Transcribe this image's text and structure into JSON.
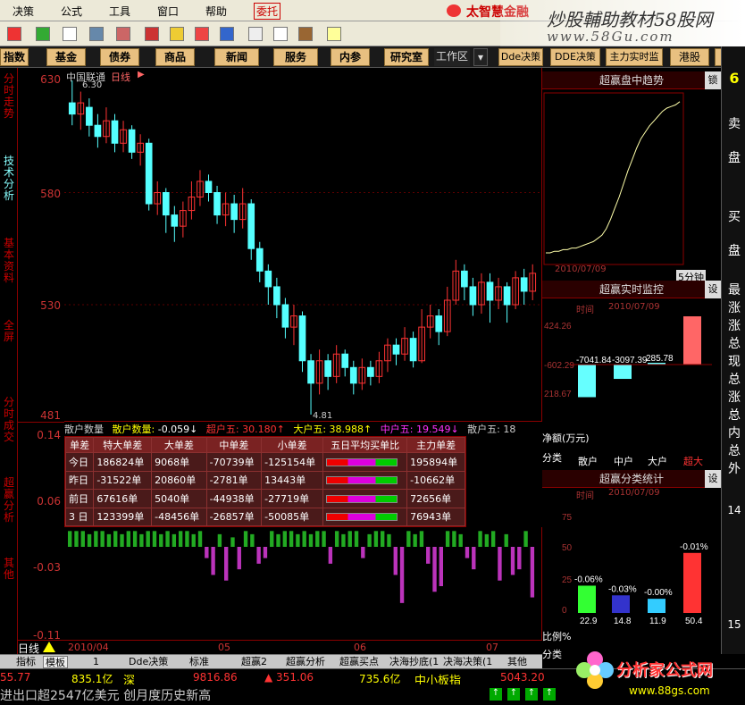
{
  "menu": {
    "items": [
      "决策",
      "公式",
      "工具",
      "窗口",
      "帮助"
    ],
    "entrust_label": "委托",
    "brand_text": "太智慧金融"
  },
  "watermark": {
    "line1": "炒股輔助教材58股网",
    "line2": "www.58Gu.com"
  },
  "nav": {
    "buttons": [
      "指数",
      "基金",
      "债券",
      "商品",
      "新闻",
      "服务",
      "内参",
      "研究室"
    ],
    "workzone_label": "工作区",
    "right_buttons": [
      "Dde决策",
      "DDE决策",
      "主力实时监",
      "港股",
      "商"
    ]
  },
  "left_tabs": [
    {
      "label": "分时走势",
      "active": false
    },
    {
      "label": "技术分析",
      "active": true
    },
    {
      "label": "基本资料",
      "active": false
    },
    {
      "label": "全屏",
      "active": false
    },
    {
      "label": "分时成交",
      "active": false
    },
    {
      "label": "超赢分析",
      "active": false
    },
    {
      "label": "其他",
      "active": false
    }
  ],
  "chart": {
    "stock_name": "中国联通",
    "period": "日线",
    "high_marker": "6.30",
    "low_marker": "4.81",
    "y_labels": [
      "630",
      "580",
      "530",
      "481"
    ],
    "candles": [
      {
        "o": 6.2,
        "c": 6.15,
        "h": 6.3,
        "l": 6.1
      },
      {
        "o": 6.15,
        "c": 6.2,
        "h": 6.25,
        "l": 6.08
      },
      {
        "o": 6.18,
        "c": 6.1,
        "h": 6.22,
        "l": 6.05
      },
      {
        "o": 6.1,
        "c": 6.05,
        "h": 6.15,
        "l": 6.0
      },
      {
        "o": 6.05,
        "c": 6.12,
        "h": 6.18,
        "l": 6.02
      },
      {
        "o": 6.12,
        "c": 6.02,
        "h": 6.15,
        "l": 5.98
      },
      {
        "o": 6.02,
        "c": 6.08,
        "h": 6.12,
        "l": 5.98
      },
      {
        "o": 6.08,
        "c": 5.98,
        "h": 6.1,
        "l": 5.95
      },
      {
        "o": 5.98,
        "c": 6.02,
        "h": 6.06,
        "l": 5.92
      },
      {
        "o": 6.02,
        "c": 5.75,
        "h": 6.04,
        "l": 5.72
      },
      {
        "o": 5.75,
        "c": 5.8,
        "h": 5.85,
        "l": 5.7
      },
      {
        "o": 5.8,
        "c": 5.7,
        "h": 5.82,
        "l": 5.62
      },
      {
        "o": 5.7,
        "c": 5.65,
        "h": 5.74,
        "l": 5.58
      },
      {
        "o": 5.65,
        "c": 5.72,
        "h": 5.76,
        "l": 5.6
      },
      {
        "o": 5.72,
        "c": 5.78,
        "h": 5.85,
        "l": 5.68
      },
      {
        "o": 5.78,
        "c": 5.85,
        "h": 5.9,
        "l": 5.74
      },
      {
        "o": 5.85,
        "c": 5.8,
        "h": 5.88,
        "l": 5.76
      },
      {
        "o": 5.8,
        "c": 5.7,
        "h": 5.83,
        "l": 5.66
      },
      {
        "o": 5.7,
        "c": 5.75,
        "h": 5.8,
        "l": 5.65
      },
      {
        "o": 5.75,
        "c": 5.68,
        "h": 5.79,
        "l": 5.62
      },
      {
        "o": 5.68,
        "c": 5.75,
        "h": 5.82,
        "l": 5.64
      },
      {
        "o": 5.75,
        "c": 5.55,
        "h": 5.77,
        "l": 5.5
      },
      {
        "o": 5.55,
        "c": 5.45,
        "h": 5.58,
        "l": 5.4
      },
      {
        "o": 5.45,
        "c": 5.38,
        "h": 5.48,
        "l": 5.3
      },
      {
        "o": 5.38,
        "c": 5.3,
        "h": 5.42,
        "l": 5.24
      },
      {
        "o": 5.3,
        "c": 5.2,
        "h": 5.33,
        "l": 5.15
      },
      {
        "o": 5.2,
        "c": 5.25,
        "h": 5.3,
        "l": 5.12
      },
      {
        "o": 5.25,
        "c": 5.05,
        "h": 5.27,
        "l": 5.0
      },
      {
        "o": 5.05,
        "c": 4.95,
        "h": 5.08,
        "l": 4.81
      },
      {
        "o": 4.95,
        "c": 5.05,
        "h": 5.1,
        "l": 4.9
      },
      {
        "o": 5.05,
        "c": 4.98,
        "h": 5.08,
        "l": 4.92
      },
      {
        "o": 4.98,
        "c": 5.08,
        "h": 5.12,
        "l": 4.95
      },
      {
        "o": 5.08,
        "c": 5.02,
        "h": 5.1,
        "l": 4.98
      },
      {
        "o": 5.02,
        "c": 4.95,
        "h": 5.05,
        "l": 4.9
      },
      {
        "o": 4.95,
        "c": 5.02,
        "h": 5.06,
        "l": 4.92
      },
      {
        "o": 5.02,
        "c": 4.98,
        "h": 5.05,
        "l": 4.94
      },
      {
        "o": 4.98,
        "c": 5.05,
        "h": 5.09,
        "l": 4.95
      },
      {
        "o": 5.05,
        "c": 5.12,
        "h": 5.15,
        "l": 5.0
      },
      {
        "o": 5.12,
        "c": 5.08,
        "h": 5.15,
        "l": 5.03
      },
      {
        "o": 5.08,
        "c": 5.15,
        "h": 5.2,
        "l": 5.05
      },
      {
        "o": 5.15,
        "c": 5.05,
        "h": 5.18,
        "l": 5.02
      },
      {
        "o": 5.05,
        "c": 5.2,
        "h": 5.28,
        "l": 5.04
      },
      {
        "o": 5.2,
        "c": 5.25,
        "h": 5.3,
        "l": 5.15
      },
      {
        "o": 5.25,
        "c": 5.18,
        "h": 5.28,
        "l": 5.12
      },
      {
        "o": 5.18,
        "c": 5.32,
        "h": 5.38,
        "l": 5.16
      },
      {
        "o": 5.32,
        "c": 5.45,
        "h": 5.5,
        "l": 5.3
      },
      {
        "o": 5.45,
        "c": 5.38,
        "h": 5.48,
        "l": 5.32
      },
      {
        "o": 5.38,
        "c": 5.3,
        "h": 5.42,
        "l": 5.25
      },
      {
        "o": 5.3,
        "c": 5.4,
        "h": 5.44,
        "l": 5.26
      },
      {
        "o": 5.4,
        "c": 5.32,
        "h": 5.44,
        "l": 5.22
      },
      {
        "o": 5.32,
        "c": 5.38,
        "h": 5.42,
        "l": 5.28
      },
      {
        "o": 5.38,
        "c": 5.3,
        "h": 5.4,
        "l": 5.22
      },
      {
        "o": 5.3,
        "c": 5.42,
        "h": 5.45,
        "l": 5.28
      },
      {
        "o": 5.42,
        "c": 5.36,
        "h": 5.46,
        "l": 5.3
      },
      {
        "o": 5.36,
        "c": 5.44,
        "h": 5.48,
        "l": 5.32
      }
    ]
  },
  "inforow": {
    "label": "散户数量",
    "value_label": "散户数量:",
    "value": "-0.059↓",
    "items": [
      "超户五: 30.180↑",
      "大户五: 38.988↑",
      "中户五: 19.549↓",
      "散户五: 18"
    ]
  },
  "dd_table": {
    "headers": [
      "单差",
      "特大单差",
      "大单差",
      "中单差",
      "小单差",
      "五日平均买单比",
      "主力单差"
    ],
    "rows": [
      [
        "今日",
        "186824单",
        "9068单",
        "-70739单",
        "-125154单",
        "",
        "195894单"
      ],
      [
        "昨日",
        "-31522单",
        "20860单",
        "-2781单",
        "13443单",
        "",
        "-10662单"
      ],
      [
        "前日",
        "67616单",
        "5040单",
        "-44938单",
        "-27719单",
        "",
        "72656单"
      ],
      [
        "3 日",
        "123399单",
        "-48456单",
        "-26857单",
        "-50085单",
        "",
        "76943单"
      ]
    ]
  },
  "indicator": {
    "y_labels": [
      "0.14",
      "0.06",
      "-0.03",
      "-0.11"
    ],
    "values": [
      0.05,
      0.05,
      0.05,
      0.04,
      0.05,
      0.05,
      0.04,
      0.05,
      0.04,
      0.05,
      0.05,
      0.04,
      0.05,
      0.05,
      0.04,
      0.05,
      0.04,
      0.05,
      0.05,
      0.04,
      0.05,
      -0.02,
      -0.05,
      0.04,
      -0.06,
      0.03,
      -0.04,
      0.05,
      0.04,
      -0.03,
      -0.02,
      0.05,
      0.04,
      0.05,
      0.05,
      0.04,
      0.05,
      0.04,
      0.05,
      0.05,
      -0.03,
      0.05,
      0.04,
      0.05,
      0.05,
      -0.02,
      0.04,
      0.05,
      0.05,
      0.04,
      -0.05,
      -0.1,
      0.05,
      0.04,
      0.05,
      -0.03,
      -0.08,
      -0.07,
      0.05,
      0.05,
      0.04,
      -0.02,
      -0.04,
      0.05,
      0.04,
      0.05,
      -0.06,
      0.04,
      -0.05,
      -0.04,
      0.05,
      -0.09
    ]
  },
  "xaxis": {
    "period": "日线",
    "dates": [
      "2010/04",
      "05",
      "06",
      "07"
    ]
  },
  "bottom_tabs": [
    "指标",
    "模板",
    "1",
    "Dde决策",
    "标准",
    "超赢2",
    "超赢分析",
    "超赢买点",
    "决海抄底(1",
    "决海决策(1",
    "其他"
  ],
  "status": {
    "left_val": "55.77",
    "vol1": "835.1亿",
    "market": "深",
    "index_val": "9816.86",
    "change": "▲ 351.06",
    "vol2": "735.6亿",
    "board": "中小板指",
    "board_val": "5043.20"
  },
  "ticker": "进出口超2547亿美元 创月度历史新高",
  "right": {
    "trend": {
      "title": "超赢盘中趋势",
      "lock_label": "锁",
      "date": "2010/07/09",
      "footer": "5分钟",
      "curve": [
        0.05,
        0.05,
        0.06,
        0.06,
        0.07,
        0.07,
        0.08,
        0.08,
        0.09,
        0.1,
        0.11,
        0.12,
        0.14,
        0.16,
        0.2,
        0.26,
        0.33,
        0.4,
        0.48,
        0.56,
        0.63,
        0.7,
        0.76,
        0.8,
        0.84,
        0.87,
        0.9,
        0.93,
        0.95,
        0.96,
        0.97,
        0.99
      ]
    },
    "monitor": {
      "title": "超赢实时监控",
      "set_label": "设",
      "time_label": "时间",
      "date": "2010/07/09",
      "y_labels": [
        "424.26",
        "-602.29",
        "218.67"
      ],
      "bar_values": [
        "-7041.84",
        "-3097.39",
        "285.78",
        "10424.26"
      ],
      "bar_vals": [
        -7041.84,
        -3097.39,
        285.78,
        10424.26
      ],
      "axis_caption": "净额(万元)",
      "category_label": "分类",
      "categories": [
        "散户",
        "中户",
        "大户",
        "超大"
      ]
    },
    "stats": {
      "title": "超赢分类统计",
      "set_label": "设",
      "time_label": "时间",
      "date": "2010/07/09",
      "y_labels": [
        "75",
        "50",
        "25",
        "0"
      ],
      "bar_labels": [
        "-0.06%",
        "-0.03%",
        "-0.00%",
        "-0.01%"
      ],
      "pct_values": [
        22.9,
        14.8,
        11.9,
        50.4
      ],
      "value_labels": [
        "22.9",
        "14.8",
        "11.9",
        "50.4"
      ],
      "ratio_label": "比例%",
      "category_label": "分类"
    }
  },
  "far_right": {
    "top_number": "6",
    "labels": [
      "卖",
      "盘",
      "买",
      "盘"
    ],
    "side_words": [
      "最",
      "涨",
      "涨",
      "总",
      "现",
      "总",
      "涨",
      "总",
      "内",
      "总",
      "外"
    ],
    "numbers": [
      "14",
      "15"
    ]
  },
  "watermark_bottom": {
    "brand": "分析家公式网",
    "url": "www.88gs.com"
  },
  "colors": {
    "up": "#ff3333",
    "down": "#55ffff",
    "frame": "#8b0000"
  }
}
